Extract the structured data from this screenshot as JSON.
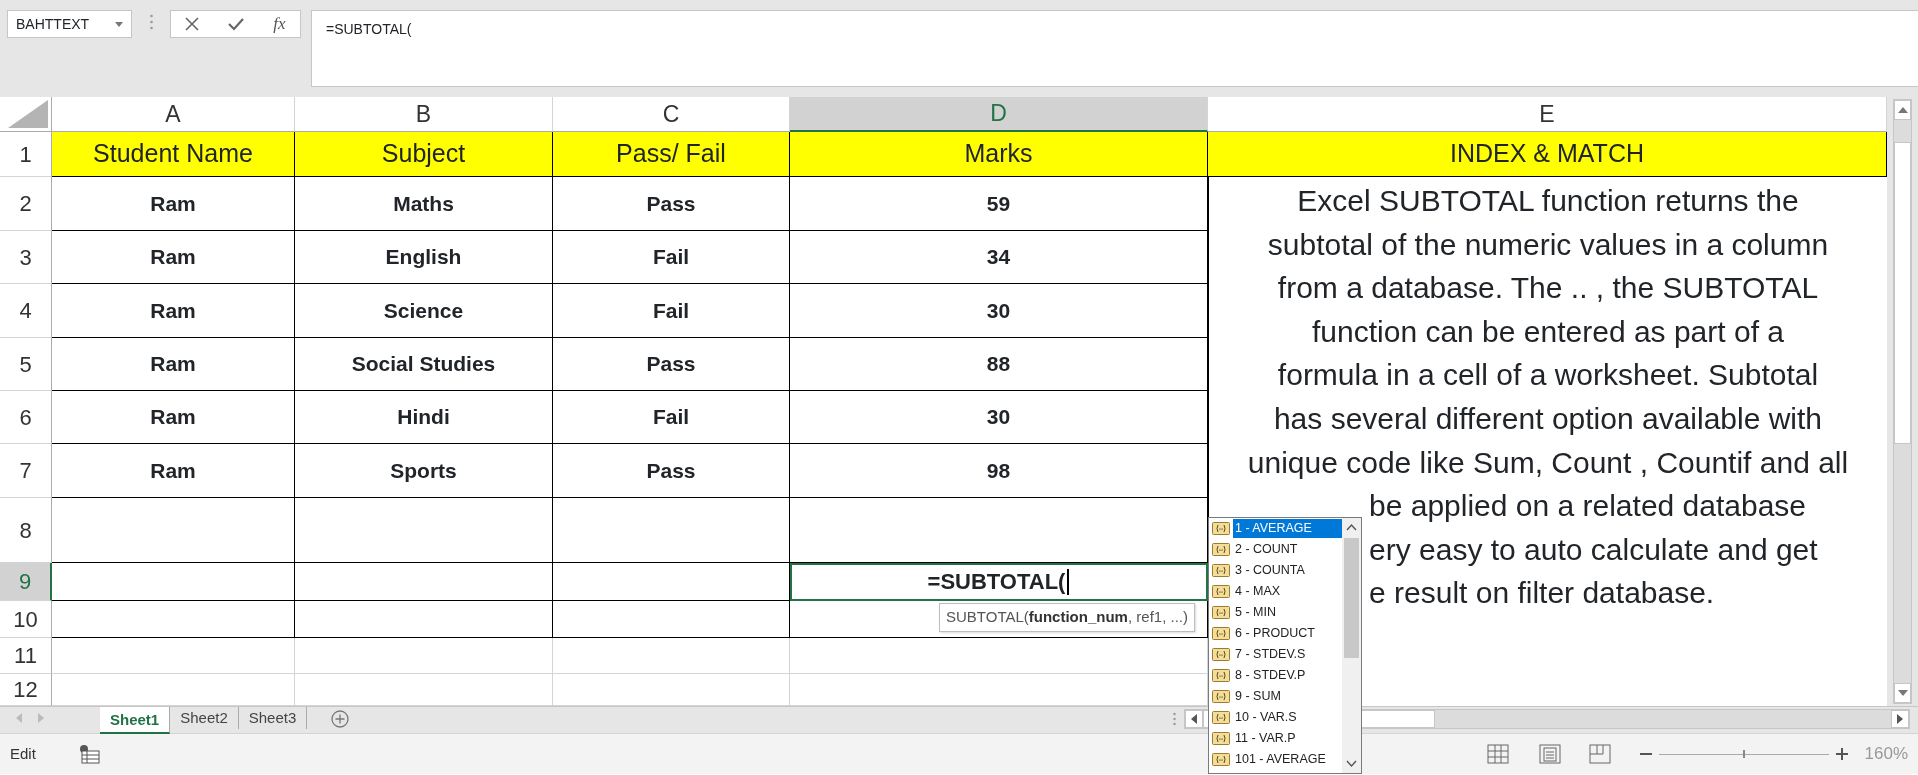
{
  "name_box": {
    "value": "BAHTTEXT"
  },
  "formula_bar": {
    "function_label": "fx",
    "formula": "=SUBTOTAL("
  },
  "columns": [
    {
      "label": "A",
      "selected": false
    },
    {
      "label": "B",
      "selected": false
    },
    {
      "label": "C",
      "selected": false
    },
    {
      "label": "D",
      "selected": true
    },
    {
      "label": "E",
      "selected": false
    }
  ],
  "rows": [
    {
      "number": "1",
      "kind": "header",
      "selected": false,
      "cells": [
        "Student Name",
        "Subject",
        "Pass/ Fail",
        "Marks",
        "INDEX & MATCH"
      ]
    },
    {
      "number": "2",
      "kind": "data",
      "selected": false,
      "cells": [
        "Ram",
        "Maths",
        "Pass",
        "59"
      ]
    },
    {
      "number": "3",
      "kind": "data",
      "selected": false,
      "cells": [
        "Ram",
        "English",
        "Fail",
        "34"
      ]
    },
    {
      "number": "4",
      "kind": "data",
      "selected": false,
      "cells": [
        "Ram",
        "Science",
        "Fail",
        "30"
      ]
    },
    {
      "number": "5",
      "kind": "data",
      "selected": false,
      "cells": [
        "Ram",
        "Social Studies",
        "Pass",
        "88"
      ]
    },
    {
      "number": "6",
      "kind": "data",
      "selected": false,
      "cells": [
        "Ram",
        "Hindi",
        "Fail",
        "30"
      ]
    },
    {
      "number": "7",
      "kind": "data",
      "selected": false,
      "cells": [
        "Ram",
        "Sports",
        "Pass",
        "98"
      ]
    },
    {
      "number": "8",
      "kind": "bordered",
      "selected": false,
      "cells": []
    },
    {
      "number": "9",
      "kind": "bordered",
      "selected": true,
      "cells": [],
      "edit_text": "=SUBTOTAL("
    },
    {
      "number": "10",
      "kind": "bordered",
      "selected": false,
      "cells": []
    },
    {
      "number": "11",
      "kind": "blank",
      "selected": false,
      "cells": []
    },
    {
      "number": "12",
      "kind": "blank",
      "selected": false,
      "cells": []
    }
  ],
  "note": {
    "lines": [
      {
        "kind": "full",
        "text": "Excel SUBTOTAL function returns the"
      },
      {
        "kind": "full",
        "text": "subtotal of the numeric values in a column"
      },
      {
        "kind": "full",
        "text": "from a database. The .. , the SUBTOTAL"
      },
      {
        "kind": "full",
        "text": "function can be entered as part of a"
      },
      {
        "kind": "full",
        "text": "formula in a cell of a worksheet. Subtotal"
      },
      {
        "kind": "full",
        "text": "has several different option available with"
      },
      {
        "kind": "full",
        "text": "unique code like Sum, Count , Countif and all"
      },
      {
        "kind": "partial",
        "text": "be applied on a related database"
      },
      {
        "kind": "partial",
        "text": "ery easy to auto calculate and get"
      },
      {
        "kind": "partial",
        "text": "e result on filter database."
      }
    ]
  },
  "tooltip": "SUBTOTAL(**function_num**, ref1, ...)",
  "autocomplete": {
    "items": [
      {
        "label": "1 - AVERAGE",
        "selected": true
      },
      {
        "label": "2 - COUNT",
        "selected": false
      },
      {
        "label": "3 - COUNTA",
        "selected": false
      },
      {
        "label": "4 - MAX",
        "selected": false
      },
      {
        "label": "5 - MIN",
        "selected": false
      },
      {
        "label": "6 - PRODUCT",
        "selected": false
      },
      {
        "label": "7 - STDEV.S",
        "selected": false
      },
      {
        "label": "8 - STDEV.P",
        "selected": false
      },
      {
        "label": "9 - SUM",
        "selected": false
      },
      {
        "label": "10 - VAR.S",
        "selected": false
      },
      {
        "label": "11 - VAR.P",
        "selected": false
      },
      {
        "label": "101 - AVERAGE",
        "selected": false
      }
    ]
  },
  "sheet_tabs": [
    {
      "label": "Sheet1",
      "selected": true
    },
    {
      "label": "Sheet2",
      "selected": false
    },
    {
      "label": "Sheet3",
      "selected": false
    }
  ],
  "status_bar": {
    "mode": "Edit",
    "zoom": "160%",
    "zoom_slider": {
      "level": 0.5
    }
  }
}
